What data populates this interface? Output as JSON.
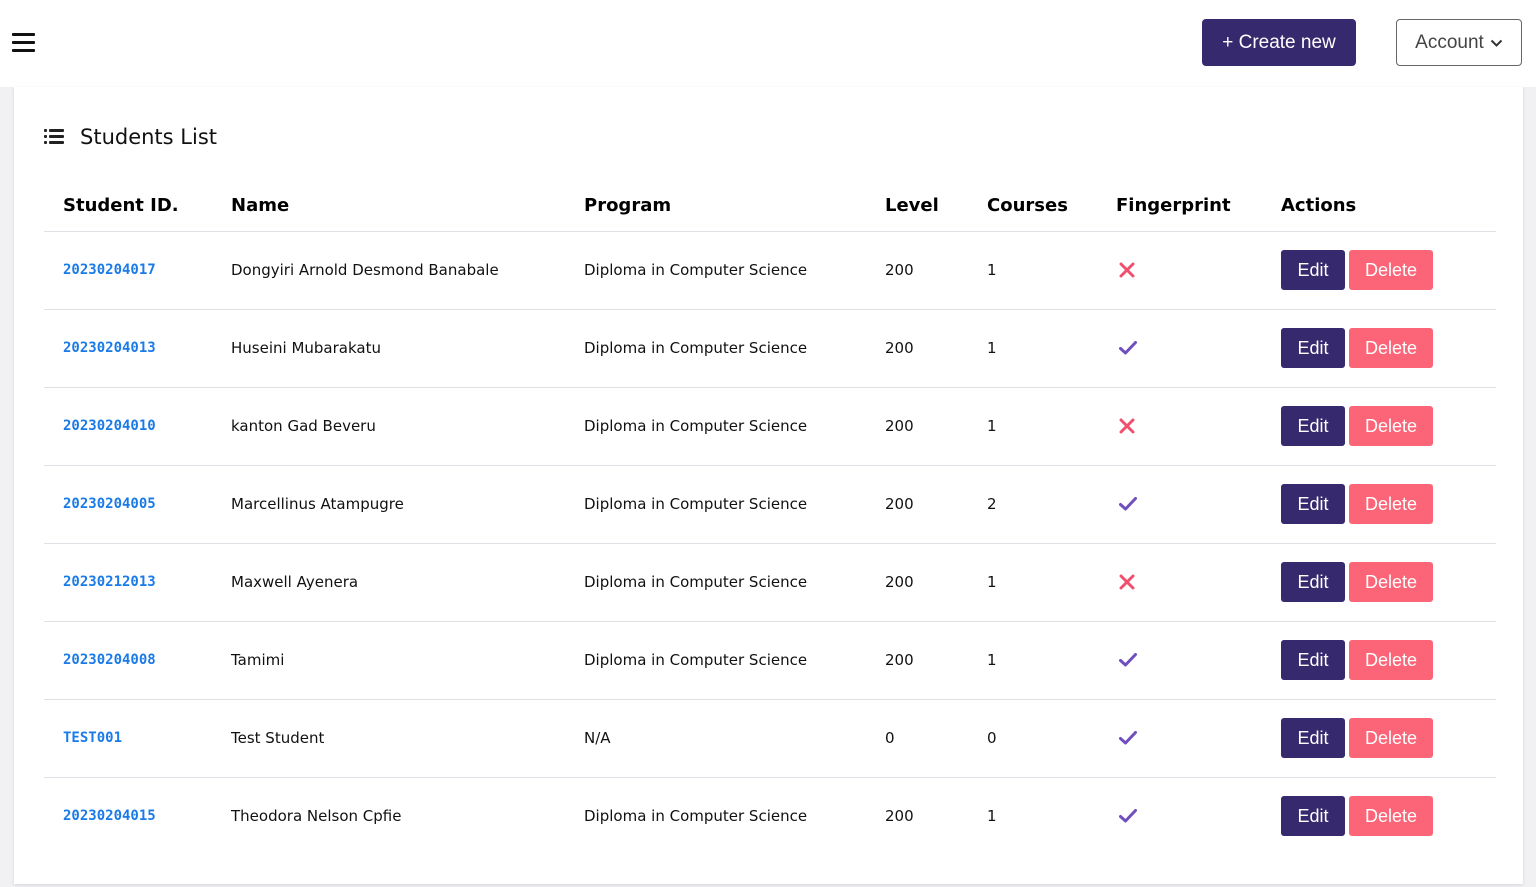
{
  "header": {
    "create_label": "+ Create new",
    "account_label": "Account"
  },
  "card": {
    "title": "Students List"
  },
  "table": {
    "columns": [
      "Student ID.",
      "Name",
      "Program",
      "Level",
      "Courses",
      "Fingerprint",
      "Actions"
    ],
    "rows": [
      {
        "id": "20230204017",
        "name": "Dongyiri Arnold Desmond Banabale",
        "program": "Diploma in Computer Science",
        "level": "200",
        "courses": "1",
        "fingerprint": false
      },
      {
        "id": "20230204013",
        "name": "Huseini Mubarakatu",
        "program": "Diploma in Computer Science",
        "level": "200",
        "courses": "1",
        "fingerprint": true
      },
      {
        "id": "20230204010",
        "name": "kanton Gad Beveru",
        "program": "Diploma in Computer Science",
        "level": "200",
        "courses": "1",
        "fingerprint": false
      },
      {
        "id": "20230204005",
        "name": "Marcellinus Atampugre",
        "program": "Diploma in Computer Science",
        "level": "200",
        "courses": "2",
        "fingerprint": true
      },
      {
        "id": "20230212013",
        "name": "Maxwell Ayenera",
        "program": "Diploma in Computer Science",
        "level": "200",
        "courses": "1",
        "fingerprint": false
      },
      {
        "id": "20230204008",
        "name": "Tamimi",
        "program": "Diploma in Computer Science",
        "level": "200",
        "courses": "1",
        "fingerprint": true
      },
      {
        "id": "TEST001",
        "name": "Test Student",
        "program": "N/A",
        "level": "0",
        "courses": "0",
        "fingerprint": true
      },
      {
        "id": "20230204015",
        "name": "Theodora Nelson Cpfie",
        "program": "Diploma in Computer Science",
        "level": "200",
        "courses": "1",
        "fingerprint": true
      }
    ],
    "edit_label": "Edit",
    "delete_label": "Delete"
  },
  "icons": {
    "menu": "hamburger-menu-icon",
    "list": "list-icon",
    "dropdown": "chevron-down-icon",
    "fingerprint_yes": "check-icon",
    "fingerprint_no": "cross-icon"
  },
  "colors": {
    "primary": "#36296d",
    "danger": "#fb6577",
    "link": "#1a7be8",
    "check": "#6f4fc0",
    "cross": "#f0506e"
  }
}
